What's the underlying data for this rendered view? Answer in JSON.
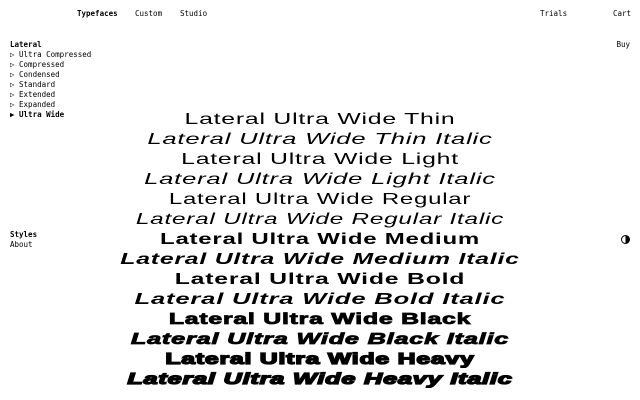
{
  "nav": {
    "typefaces": "Typefaces",
    "custom": "Custom",
    "studio": "Studio",
    "trials": "Trials",
    "cart": "Cart"
  },
  "family": {
    "title": "Lateral",
    "widths": [
      "▷ Ultra Compressed",
      "▷ Compressed",
      "▷ Condensed",
      "▷ Standard",
      "▷ Extended",
      "▷ Expanded",
      "▶ Ultra Wide"
    ]
  },
  "buy": "Buy",
  "sidebar_bottom": {
    "styles": "Styles",
    "about": "About"
  },
  "theme_icon": "half-circle-contrast-icon",
  "specimen": [
    "Lateral Ultra Wide Thin",
    "Lateral Ultra Wide Thin Italic",
    "Lateral Ultra Wide Light",
    "Lateral Ultra Wide Light Italic",
    "Lateral Ultra Wide Regular",
    "Lateral Ultra Wide Regular Italic",
    "Lateral Ultra Wide Medium",
    "Lateral Ultra Wide Medium Italic",
    "Lateral Ultra Wide Bold",
    "Lateral Ultra Wide Bold Italic",
    "Lateral Ultra Wide Black",
    "Lateral Ultra Wide Black Italic",
    "Lateral Ultra Wide Heavy",
    "Lateral Ultra Wide Heavy Italic"
  ]
}
